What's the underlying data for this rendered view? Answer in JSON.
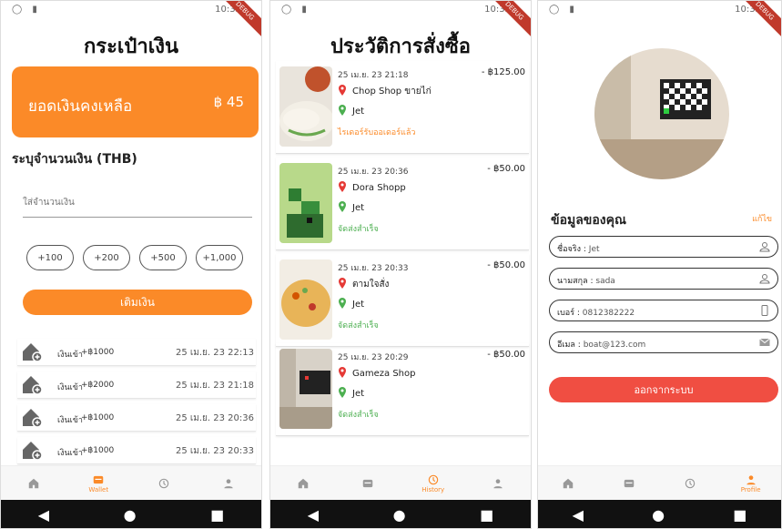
{
  "status_bar": {
    "time": "10:32",
    "badge": "DEBUG"
  },
  "wallet": {
    "title": "กระเป๋าเงิน",
    "balance_label": "ยอดเงินคงเหลือ",
    "balance_value": "฿ 45",
    "amount_label": "ระบุจำนวนเงิน (THB)",
    "amount_placeholder": "ใส่จำนวนเงิน",
    "chips": [
      "+100",
      "+200",
      "+500",
      "+1,000"
    ],
    "topup_button": "เติมเงิน",
    "transactions": [
      {
        "label": "เงินเข้า",
        "amount": "+฿1000",
        "date": "25 เม.ย. 23 22:13"
      },
      {
        "label": "เงินเข้า",
        "amount": "+฿2000",
        "date": "25 เม.ย. 23 21:18"
      },
      {
        "label": "เงินเข้า",
        "amount": "+฿1000",
        "date": "25 เม.ย. 23 20:36"
      },
      {
        "label": "เงินเข้า",
        "amount": "+฿1000",
        "date": "25 เม.ย. 23 20:33"
      }
    ]
  },
  "history": {
    "title": "ประวัติการสั่งซื้อ",
    "orders": [
      {
        "date": "25 เม.ย. 23 21:18",
        "price": "- ฿125.00",
        "shop": "Chop Shop ขายไก่",
        "customer": "Jet",
        "status": "ไรเดอร์รับออเดอร์แล้ว",
        "status_color": "#fb8a28"
      },
      {
        "date": "25 เม.ย. 23 20:36",
        "price": "- ฿50.00",
        "shop": "Dora Shopp",
        "customer": "Jet",
        "status": "จัดส่งสำเร็จ",
        "status_color": "#4caf50"
      },
      {
        "date": "25 เม.ย. 23 20:33",
        "price": "- ฿50.00",
        "shop": "ตามใจสั่ง",
        "customer": "Jet",
        "status": "จัดส่งสำเร็จ",
        "status_color": "#4caf50"
      },
      {
        "date": "25 เม.ย. 23 20:29",
        "price": "- ฿50.00",
        "shop": "Gameza Shop",
        "customer": "Jet",
        "status": "จัดส่งสำเร็จ",
        "status_color": "#4caf50"
      }
    ]
  },
  "profile": {
    "section_title": "ข้อมูลของคุณ",
    "edit_label": "แก้ไข",
    "fields": [
      {
        "label": "ชื่อจริง :",
        "value": "Jet",
        "icon": "person-icon"
      },
      {
        "label": "นามสกุล :",
        "value": "sada",
        "icon": "person-icon"
      },
      {
        "label": "เบอร์ :",
        "value": "0812382222",
        "icon": "phone-icon"
      },
      {
        "label": "อีเมล :",
        "value": "boat@123.com",
        "icon": "mail-icon"
      }
    ],
    "logout_button": "ออกจากระบบ"
  },
  "nav": {
    "wallet_label": "Wallet",
    "history_label": "History",
    "profile_label": "Profile"
  },
  "colors": {
    "accent": "#fb8a28",
    "danger": "#f04e42",
    "pin_red": "#e53935",
    "pin_green": "#4caf50"
  }
}
